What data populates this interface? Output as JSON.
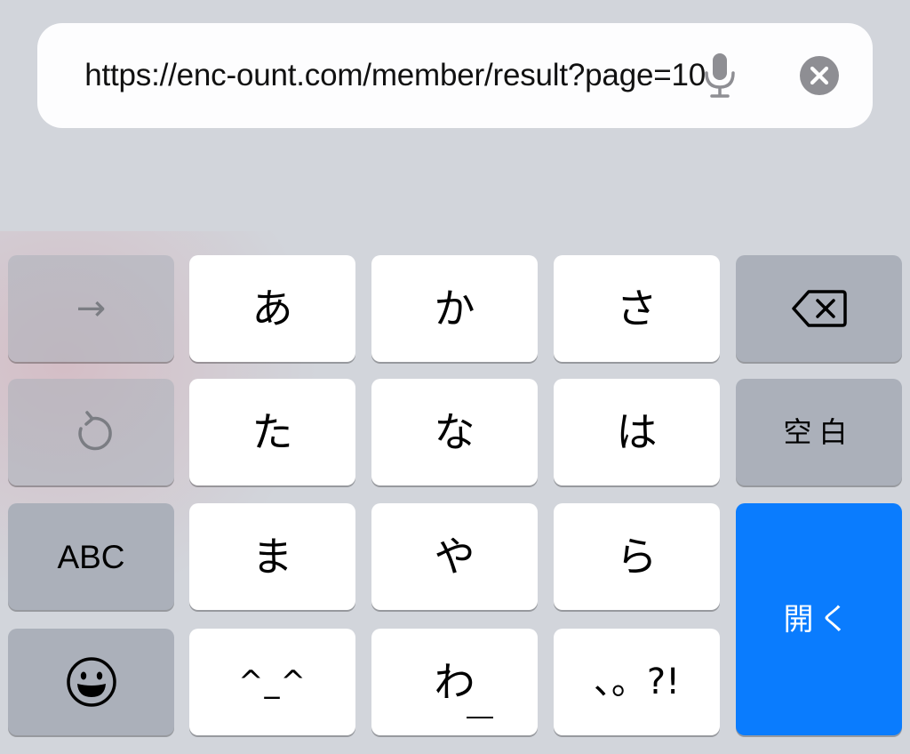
{
  "address_bar": {
    "url": "https://enc-ount.com/member/result?page=10",
    "mic_icon": "microphone-icon",
    "clear_icon": "clear-circle-x-icon"
  },
  "keyboard": {
    "left_column": {
      "next_arrow": "→",
      "undo_icon": "undo-arrow-icon",
      "abc": "ABC",
      "emoji_icon": "smiley-face-icon"
    },
    "kana_rows": [
      [
        "あ",
        "か",
        "さ"
      ],
      [
        "た",
        "な",
        "は"
      ],
      [
        "ま",
        "や",
        "ら"
      ],
      [
        "^_^",
        "わ",
        "、。?!"
      ]
    ],
    "right_column": {
      "delete_icon": "backspace-icon",
      "space": "空白",
      "return": "開く"
    }
  },
  "colors": {
    "background": "#d2d5db",
    "letter_key": "#ffffff",
    "function_key": "#abb0ba",
    "return_key": "#0a7cfe"
  }
}
